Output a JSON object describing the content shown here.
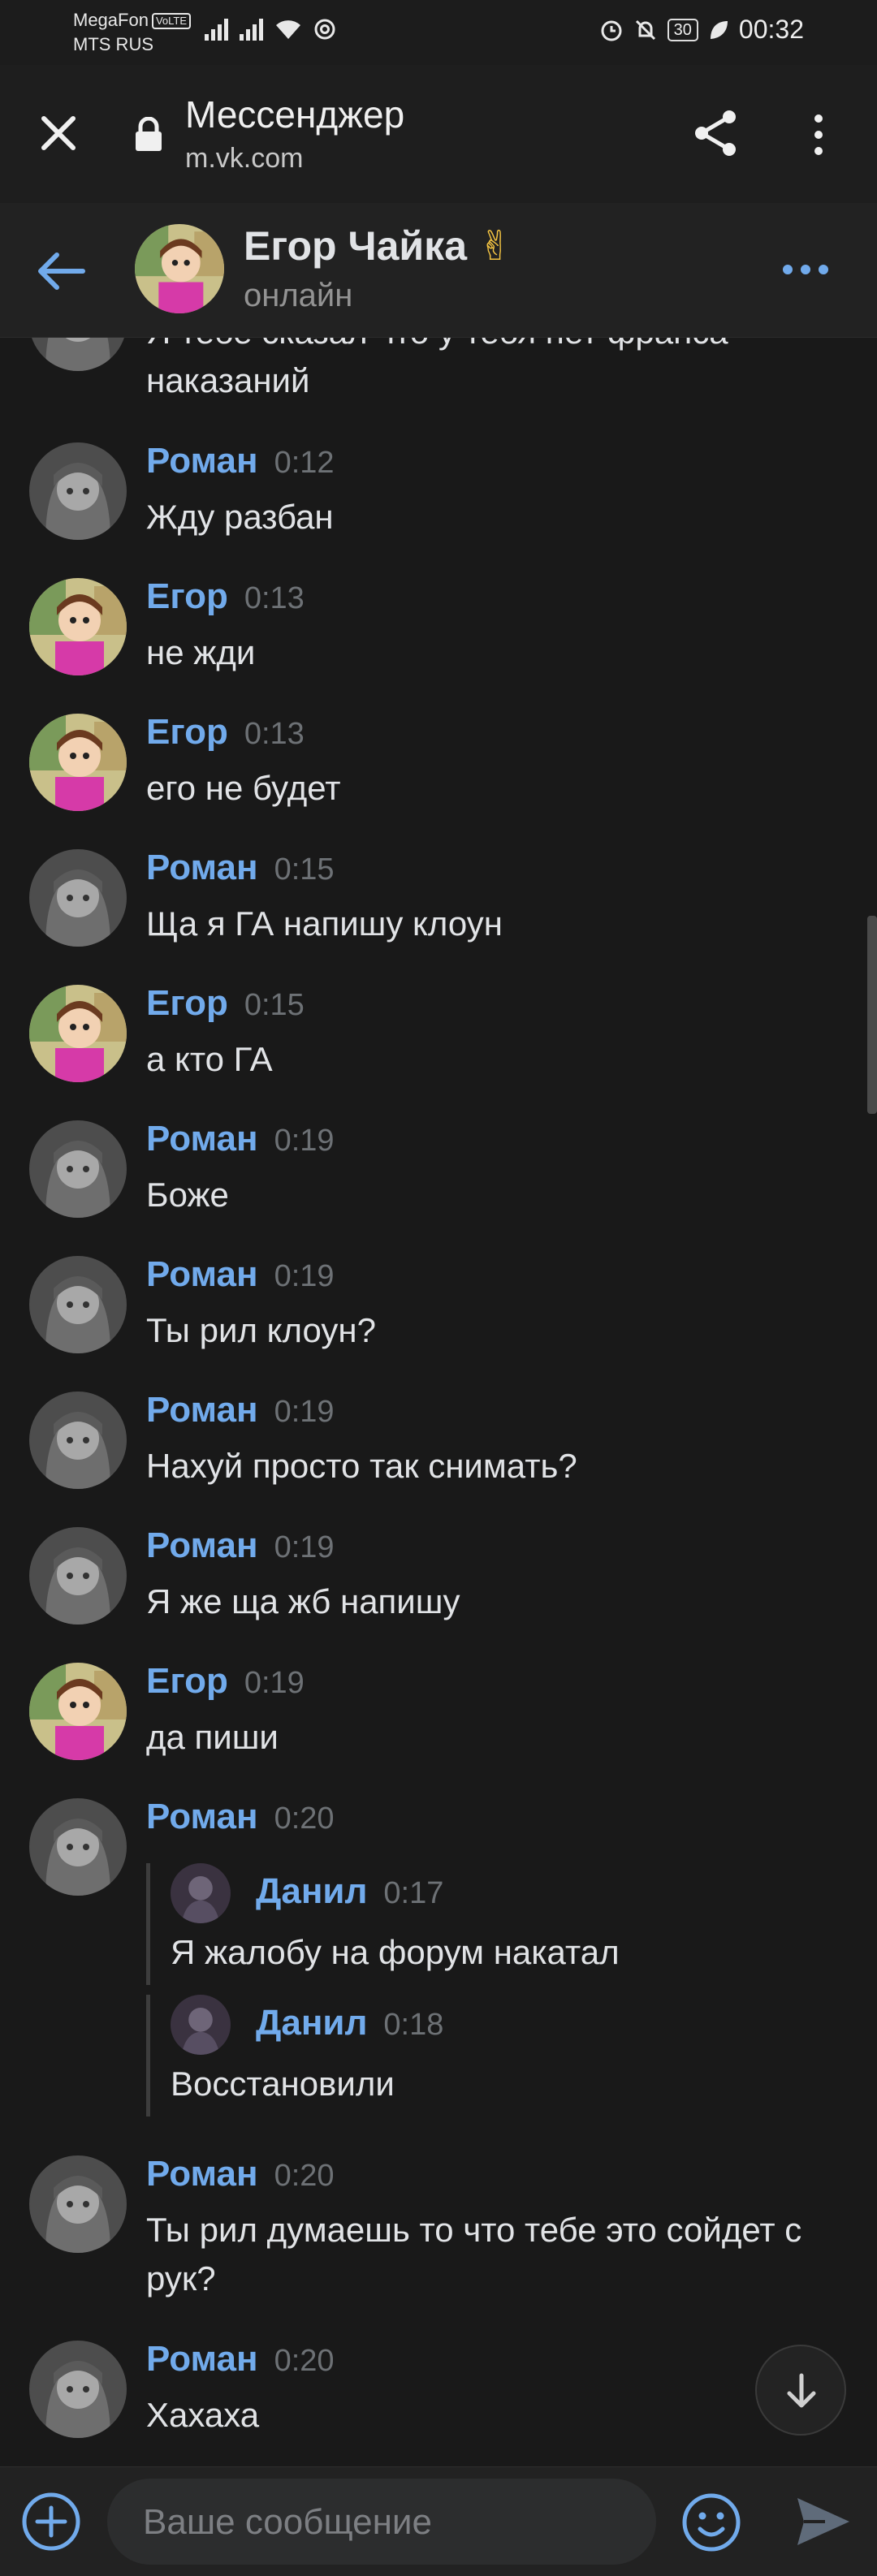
{
  "status_bar": {
    "carrier_1": "MegaFon",
    "volte": "VoLTE",
    "carrier_2": "MTS RUS",
    "battery": "30",
    "time": "00:32"
  },
  "browser": {
    "title": "Мессенджер",
    "url": "m.vk.com"
  },
  "chat": {
    "name": "Егор Чайка",
    "name_emoji": "✌",
    "status": "онлайн"
  },
  "partial_message": {
    "line_1": "Я тебе сказал что у тебя нет франса",
    "line_2": "наказаний"
  },
  "messages": [
    {
      "author": "Роман",
      "time": "0:12",
      "text": "Жду разбан"
    },
    {
      "author": "Егор",
      "time": "0:13",
      "text": "не жди"
    },
    {
      "author": "Егор",
      "time": "0:13",
      "text": "его не будет"
    },
    {
      "author": "Роман",
      "time": "0:15",
      "text": "Ща я ГА напишу клоун"
    },
    {
      "author": "Егор",
      "time": "0:15",
      "text": "а кто ГА"
    },
    {
      "author": "Роман",
      "time": "0:19",
      "text": "Боже"
    },
    {
      "author": "Роман",
      "time": "0:19",
      "text": "Ты рил клоун?"
    },
    {
      "author": "Роман",
      "time": "0:19",
      "text": "Нахуй просто так снимать?"
    },
    {
      "author": "Роман",
      "time": "0:19",
      "text": "Я же ща жб напишу"
    },
    {
      "author": "Егор",
      "time": "0:19",
      "text": "да пиши"
    },
    {
      "author": "Роман",
      "time": "0:20",
      "forwarded": [
        {
          "author": "Данил",
          "time": "0:17",
          "text": "Я жалобу на форум накатал"
        },
        {
          "author": "Данил",
          "time": "0:18",
          "text": "Восстановили"
        }
      ]
    },
    {
      "author": "Роман",
      "time": "0:20",
      "text_line_1": "Ты рил думаешь то что тебе это сойдет с",
      "text_line_2": "рук?"
    },
    {
      "author": "Роман",
      "time": "0:20",
      "text": "Хахаха"
    }
  ],
  "composer": {
    "placeholder": "Ваше сообщение"
  },
  "icons": {
    "close": "close-icon",
    "lock": "lock-icon",
    "share": "share-icon",
    "menu": "more-vertical-icon",
    "back": "back-arrow-icon",
    "more": "more-horizontal-icon",
    "scroll_down": "arrow-down-icon",
    "add": "plus-circle-icon",
    "emoji": "smile-icon",
    "send": "send-icon"
  },
  "colors": {
    "background": "#191919",
    "accent": "#71aaeb",
    "text": "#e1e3e6",
    "muted": "#6d7175"
  }
}
